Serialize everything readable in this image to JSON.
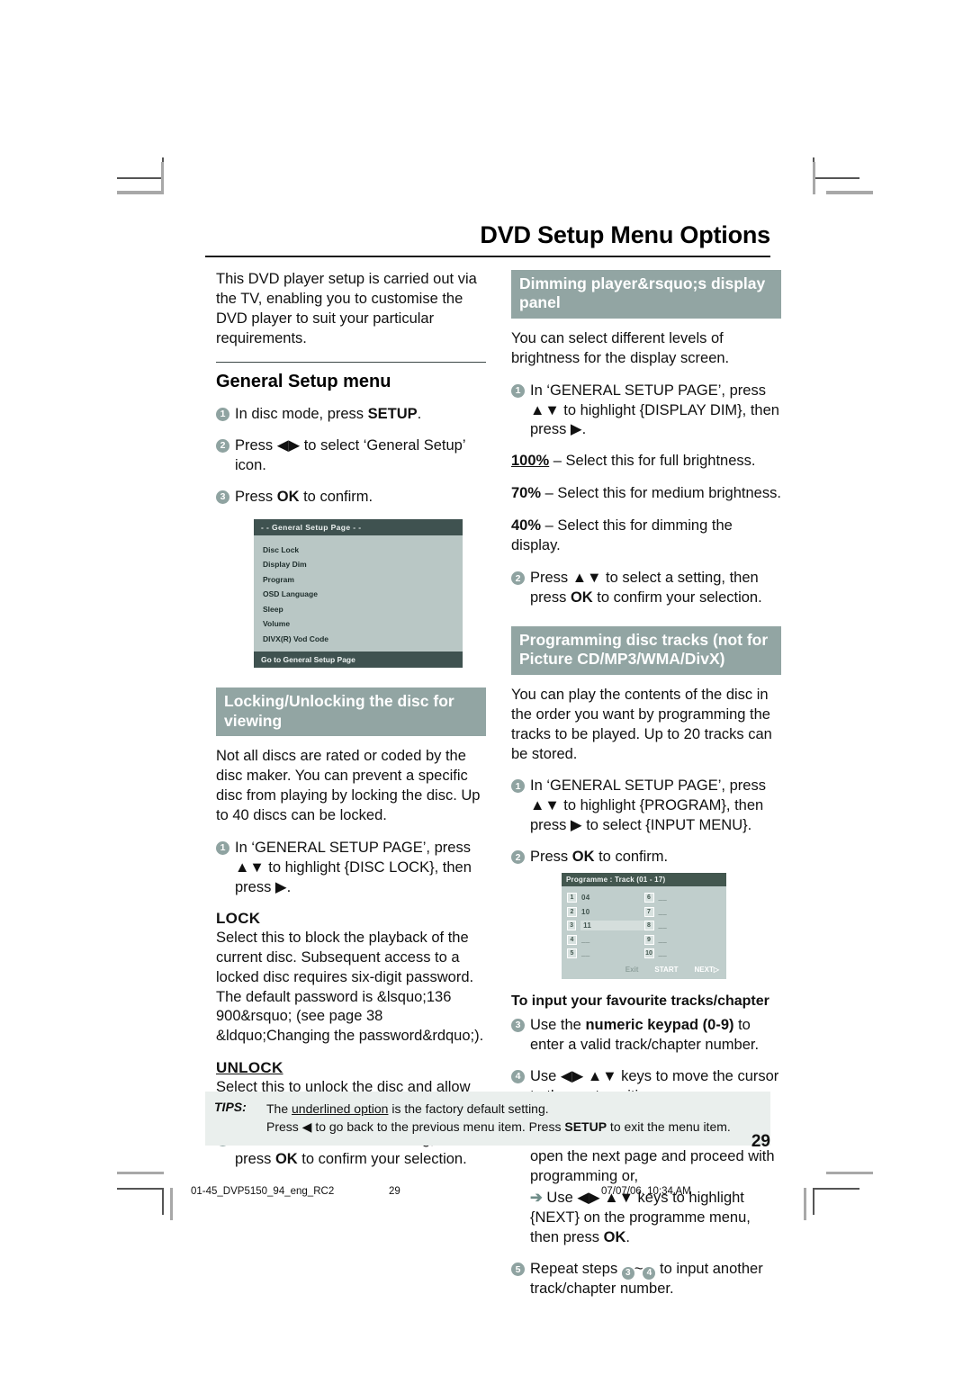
{
  "header": {
    "title": "DVD Setup Menu Options"
  },
  "left": {
    "intro": "This DVD player setup is carried out via the TV, enabling you to customise the DVD player to suit your particular requirements.",
    "general_setup_heading": "General Setup menu",
    "steps": [
      {
        "n": "1",
        "html": "In disc mode, press <span class=\"b\">SETUP</span>."
      },
      {
        "n": "2",
        "html": "Press &#9664;&#9654; to select &lsquo;General Setup&rsquo; icon."
      },
      {
        "n": "3",
        "html": "Press <span class=\"b\">OK</span> to confirm."
      }
    ],
    "osd": {
      "title": "- -   General Setup Page   - -",
      "items": [
        "Disc Lock",
        "Display Dim",
        "Program",
        "OSD Language",
        "Sleep",
        "Volume",
        "DIVX(R) Vod Code"
      ],
      "footer": "Go to General Setup Page"
    },
    "lock_section": {
      "bar": "Locking/Unlocking the disc for viewing",
      "body": "Not all discs are rated or coded by the disc maker. You can prevent a specific disc from playing by locking the disc.  Up to 40 discs can be locked.",
      "step1": "In &lsquo;GENERAL SETUP PAGE&rsquo;, press &#9650;&#9660; to highlight {DISC LOCK}, then press &#9654;.",
      "lock_heading": "LOCK",
      "lock_body": "Select this to block the playback of the current disc.  Subsequent access to a locked disc requires six-digit password. The default password is &lsquo;136 900&rsquo; (see page 38 &ldquo;Changing the password&rdquo;).",
      "unlock_heading": "UNLOCK",
      "unlock_body": "Select this to unlock the disc and allow future playback.",
      "step2": "Press &#9650;&nbsp;&#9660; to select a setting, then press <span class=\"b\">OK</span> to confirm your selection."
    }
  },
  "right": {
    "dim_section": {
      "bar": "Dimming player&rsquo;s display panel",
      "body": "You can select different levels of brightness for the display screen.",
      "step1": "In &lsquo;GENERAL SETUP PAGE&rsquo;, press &#9650;&#9660; to highlight {DISPLAY DIM}, then press &#9654;.",
      "options": [
        {
          "label": "100%",
          "underline": true,
          "text": " &ndash; Select this for full brightness."
        },
        {
          "label": "70%",
          "underline": false,
          "text": " &ndash; Select this for medium brightness."
        },
        {
          "label": "40%",
          "underline": false,
          "text": " &ndash; Select this for dimming the display."
        }
      ],
      "step2": "Press &#9650;&#9660; to select a setting, then press <span class=\"b\">OK</span> to confirm your selection."
    },
    "prog_section": {
      "bar": "Programming disc tracks (not for Picture CD/MP3/WMA/DivX)",
      "body": "You can play the contents of the disc in the order you want by programming the tracks to be played. Up to 20 tracks can be stored.",
      "step1": "In &lsquo;GENERAL SETUP PAGE&rsquo;, press &#9650;&#9660; to highlight {PROGRAM}, then press &#9654; to select {INPUT MENU}.",
      "step2": "Press <span class=\"b\">OK</span> to confirm."
    },
    "prog_osd": {
      "title": "Programme : Track (01 - 17)",
      "left_rows": [
        {
          "n": "1",
          "value": "04",
          "selected": false
        },
        {
          "n": "2",
          "value": "10",
          "selected": false
        },
        {
          "n": "3",
          "value": "11",
          "selected": true
        },
        {
          "n": "4",
          "value": "__",
          "selected": false
        },
        {
          "n": "5",
          "value": "__",
          "selected": false
        }
      ],
      "right_rows": [
        {
          "n": "6",
          "value": "__",
          "selected": false
        },
        {
          "n": "7",
          "value": "__",
          "selected": false
        },
        {
          "n": "8",
          "value": "__",
          "selected": false
        },
        {
          "n": "9",
          "value": "__",
          "selected": false
        },
        {
          "n": "10",
          "value": "__",
          "selected": false
        }
      ],
      "exit": "Exit",
      "start": "START",
      "next": "NEXT"
    },
    "fav_heading": "To input your favourite tracks/chapter",
    "step3": "Use the <span class=\"b\">numeric keypad (0-9)</span> to enter a valid track/chapter number.",
    "step4": "Use &#9664;&#9654; &#9650;&#9660; keys to move the cursor to the next position.",
    "sub_a": "If there are more than ten track/chapters, press <span class=\"b\">NEXT</span> &#9654;&#9475; to open the next page and proceed with programming or,",
    "sub_b": "Use &#9664;&#9654; &#9650;&#9660; keys to highlight {NEXT} on the programme menu, then press <span class=\"b\">OK</span>.",
    "step5_pre": "Repeat steps ",
    "step5_mid": "~",
    "step5_post": " to input another track/chapter number.",
    "step5_a": "3",
    "step5_b": "4"
  },
  "tips": {
    "label": "TIPS:",
    "line1_pre": "The ",
    "line1_underlined": "underlined option",
    "line1_post": " is the factory default setting.",
    "line2": "Press &#9664; to go back to the previous menu item. Press <span class=\"b\">SETUP</span> to exit the menu item."
  },
  "page_number": "29",
  "printer_footer": {
    "file": "01-45_DVP5150_94_eng_RC2",
    "page": "29",
    "timestamp": "07/07/06, 10:34 AM"
  },
  "colors": {
    "section_bar": "#92a5a3",
    "bullet": "#8fa3a1",
    "osd_dark": "#3f5250",
    "osd_light": "#b9c7c5",
    "tips_bg": "#eaefed"
  }
}
